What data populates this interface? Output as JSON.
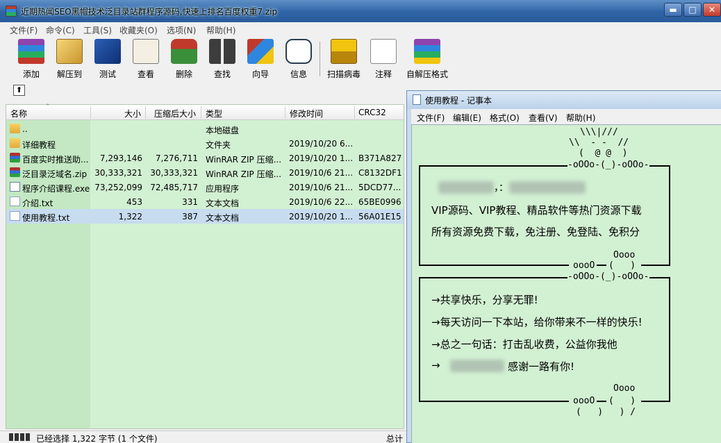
{
  "winrar": {
    "title": "近期热闻SEO黑帽技术泛目录站群程序源码,快速上排名百度权重7.zip",
    "controls": {
      "minimize": "▬",
      "maximize": "□",
      "close": "✕"
    },
    "menu": [
      "文件(F)",
      "命令(C)",
      "工具(S)",
      "收藏夹(O)",
      "选项(N)",
      "帮助(H)"
    ],
    "toolbar": [
      {
        "label": "添加",
        "icon": "add-archive-icon"
      },
      {
        "label": "解压到",
        "icon": "extract-to-icon"
      },
      {
        "label": "测试",
        "icon": "test-icon"
      },
      {
        "label": "查看",
        "icon": "view-icon"
      },
      {
        "label": "删除",
        "icon": "delete-icon"
      },
      {
        "label": "查找",
        "icon": "find-icon"
      },
      {
        "label": "向导",
        "icon": "wizard-icon"
      },
      {
        "label": "信息",
        "icon": "info-icon"
      },
      {
        "label": "扫描病毒",
        "icon": "virus-scan-icon"
      },
      {
        "label": "注释",
        "icon": "comment-icon"
      },
      {
        "label": "自解压格式",
        "icon": "sfx-icon"
      }
    ],
    "up_button": "⬆",
    "columns": [
      "名称",
      "大小",
      "压缩后大小",
      "类型",
      "修改时间",
      "CRC32"
    ],
    "rows": [
      {
        "icon": "folder",
        "name": "..",
        "size": "",
        "packed": "",
        "type": "本地磁盘",
        "modified": "",
        "crc": ""
      },
      {
        "icon": "folder",
        "name": "详细教程",
        "size": "",
        "packed": "",
        "type": "文件夹",
        "modified": "2019/10/20 6...",
        "crc": ""
      },
      {
        "icon": "rar",
        "name": "百度实时推送助...",
        "size": "7,293,146",
        "packed": "7,276,711",
        "type": "WinRAR ZIP 压缩...",
        "modified": "2019/10/20 1...",
        "crc": "B371A827"
      },
      {
        "icon": "rar",
        "name": "泛目录泛域名.zip",
        "size": "30,333,321",
        "packed": "30,333,321",
        "type": "WinRAR ZIP 压缩...",
        "modified": "2019/10/6 21...",
        "crc": "C8132DF1"
      },
      {
        "icon": "exe",
        "name": "程序介绍课程.exe",
        "size": "73,252,099",
        "packed": "72,485,717",
        "type": "应用程序",
        "modified": "2019/10/6 21...",
        "crc": "5DCD77..."
      },
      {
        "icon": "txt",
        "name": "介绍.txt",
        "size": "453",
        "packed": "331",
        "type": "文本文档",
        "modified": "2019/10/6 22...",
        "crc": "65BE0996"
      },
      {
        "icon": "txt",
        "name": "使用教程.txt",
        "size": "1,322",
        "packed": "387",
        "type": "文本文档",
        "modified": "2019/10/20 1...",
        "crc": "56A01E15"
      }
    ],
    "status": "已经选择 1,322 字节 (1 个文件)",
    "status_total": "总计"
  },
  "notepad": {
    "title": "使用教程 - 记事本",
    "menu": [
      "文件(F)",
      "编辑(E)",
      "格式(O)",
      "查看(V)",
      "帮助(H)"
    ],
    "art": {
      "hair": "\\\\\\|///",
      "brow": "\\\\  - -  //",
      "face": "(  @ @  )",
      "top1": "-oOOo-(_)-oOOo-",
      "oooo1": "Oooo",
      "bottom1a": "oooO",
      "bottom1b": "(   )",
      "top2": "-oOOo-(_)-oOOo-",
      "oooo2": "Oooo",
      "bottom2a": "oooO",
      "bottom2b": "(   )",
      "feet": "(   )   ) /"
    },
    "box1": {
      "comma": "，：",
      "line1": "VIP源码、VIP教程、精品软件等热门资源下载",
      "line2": "所有资源免费下载，免注册、免登陆、免积分"
    },
    "box2": {
      "line1": "→共享快乐，分享无罪!",
      "line2": "→每天访问一下本站，给你带来不一样的快乐!",
      "line3": "→总之一句话：打击乱收费，公益你我他",
      "line4_arrow": "→",
      "line4_tail": "感谢一路有你!"
    }
  }
}
